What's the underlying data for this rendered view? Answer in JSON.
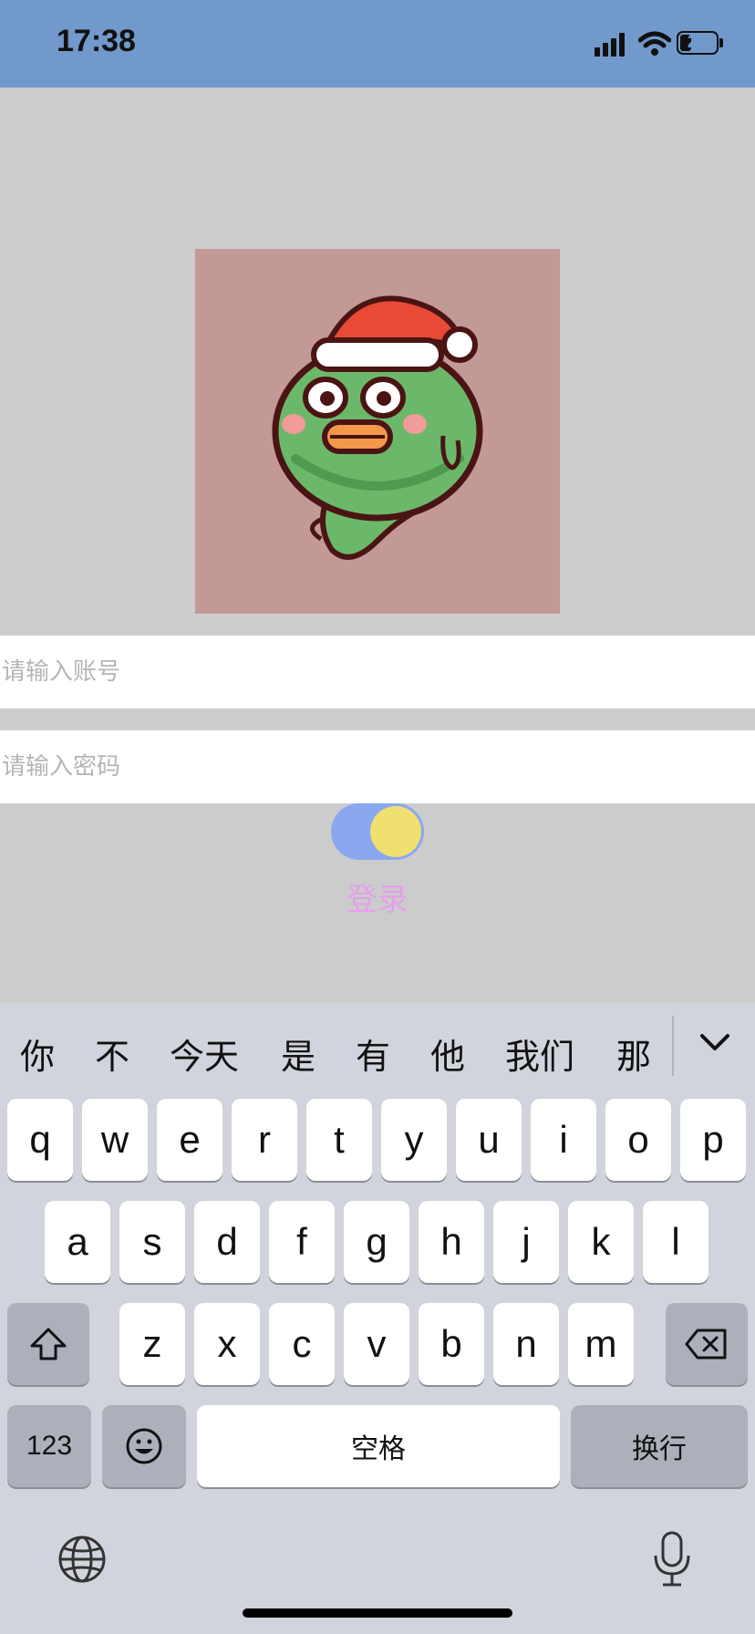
{
  "status_bar": {
    "time": "17:38",
    "battery": "28"
  },
  "avatar": {
    "description_icon": "green-fish-santa-hat-icon"
  },
  "form": {
    "account_placeholder": "请输入账号",
    "password_placeholder": "请输入密码",
    "toggle_on": true,
    "login_label": "登录"
  },
  "keyboard": {
    "candidates": [
      "你",
      "不",
      "今天",
      "是",
      "有",
      "他",
      "我们",
      "那"
    ],
    "row1": [
      "q",
      "w",
      "e",
      "r",
      "t",
      "y",
      "u",
      "i",
      "o",
      "p"
    ],
    "row2": [
      "a",
      "s",
      "d",
      "f",
      "g",
      "h",
      "j",
      "k",
      "l"
    ],
    "row3": [
      "z",
      "x",
      "c",
      "v",
      "b",
      "n",
      "m"
    ],
    "numbers_label": "123",
    "space_label": "空格",
    "return_label": "换行"
  },
  "colors": {
    "status_bar": "#7299cc",
    "page_background": "#cccccc",
    "avatar_background": "#c29996",
    "login_text": "#e4a0ea",
    "toggle_track": "#8aa8f0",
    "toggle_knob": "#f0e070"
  }
}
